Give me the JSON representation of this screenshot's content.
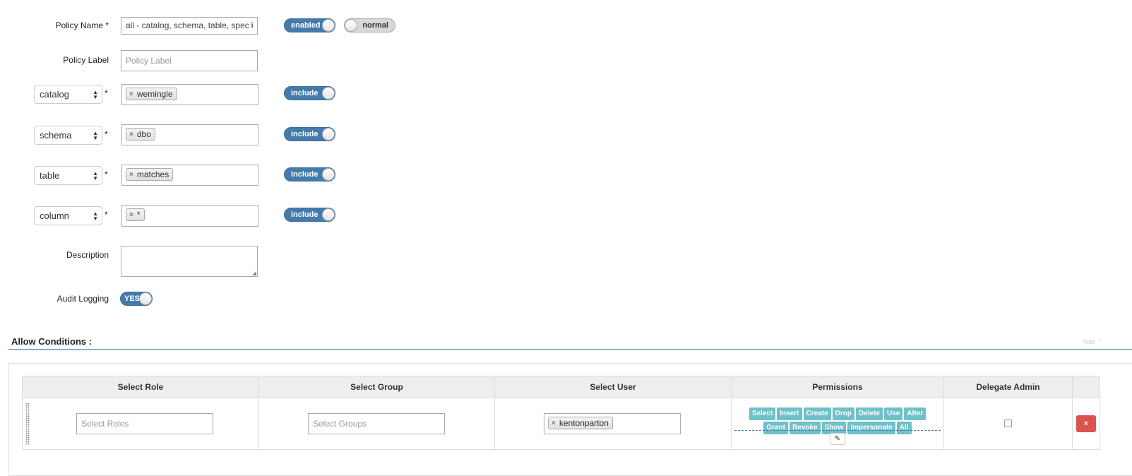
{
  "form": {
    "policy_name": {
      "label": "Policy Name *",
      "value": "all - catalog, schema, table, spec",
      "info_icon": "info-icon"
    },
    "policy_status_toggle": {
      "label": "enabled",
      "state": "on"
    },
    "policy_priority_toggle": {
      "label": "normal",
      "state": "off"
    },
    "policy_label": {
      "label": "Policy Label",
      "placeholder": "Policy Label"
    },
    "resources": [
      {
        "type": "catalog",
        "required_marker": "*",
        "tag": "wemingle",
        "toggle": "include"
      },
      {
        "type": "schema",
        "required_marker": "*",
        "tag": "dbo",
        "toggle": "include"
      },
      {
        "type": "table",
        "required_marker": "*",
        "tag": "matches",
        "toggle": "include"
      },
      {
        "type": "column",
        "required_marker": "*",
        "tag": "*",
        "toggle": "include"
      }
    ],
    "description": {
      "label": "Description",
      "value": ""
    },
    "audit_logging": {
      "label": "Audit Logging",
      "toggle": "YES"
    }
  },
  "allow_conditions": {
    "title": "Allow Conditions :",
    "hide_link": "hide ⌃",
    "columns": [
      "Select Role",
      "Select Group",
      "Select User",
      "Permissions",
      "Delegate Admin",
      ""
    ],
    "rows": [
      {
        "roles_placeholder": "Select Roles",
        "groups_placeholder": "Select Groups",
        "user_tag": "kentonparton",
        "permissions": [
          "Select",
          "Insert",
          "Create",
          "Drop",
          "Delete",
          "Use",
          "Alter",
          "Grant",
          "Revoke",
          "Show",
          "Impersonate",
          "All"
        ],
        "delegate_admin": false,
        "delete_label": "×"
      }
    ]
  },
  "colors": {
    "toggle_on": "#447bab",
    "permission_badge": "#6ec0c9",
    "delete_button": "#d9534f",
    "section_rule": "#447bab"
  }
}
